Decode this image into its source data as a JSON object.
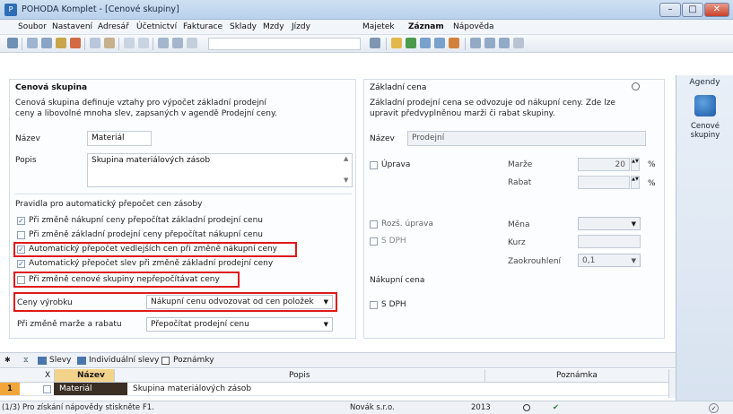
{
  "window": {
    "title": "POHODA Komplet - [Cenové skupiny]"
  },
  "menu": [
    "Soubor",
    "Nastavení",
    "Adresář",
    "Účetnictví",
    "Fakturace",
    "Sklady",
    "Mzdy",
    "Jízdy",
    "Majetek",
    "Záznam",
    "Nápověda"
  ],
  "left": {
    "section_title": "Cenová skupina",
    "description": "Cenová skupina definuje vztahy pro výpočet základní prodejní ceny a libovolné mnoha slev, zapsaných v agendě Prodejní ceny.",
    "name_label": "Název",
    "name_value": "Materiál",
    "desc_label": "Popis",
    "desc_value": "Skupina materiálových zásob",
    "rules_title": "Pravidla pro automatický přepočet cen zásoby",
    "checks": [
      {
        "label": "Při změně nákupní ceny přepočítat základní prodejní cenu",
        "checked": true
      },
      {
        "label": "Při změně základní prodejní ceny přepočítat nákupní cenu",
        "checked": false
      },
      {
        "label": "Automatický přepočet vedlejších cen při změně nákupní ceny",
        "checked": true
      },
      {
        "label": "Automatický přepočet slev při změně základní prodejní ceny",
        "checked": true
      },
      {
        "label": "Při změně cenové skupiny nepřepočítávat ceny",
        "checked": false
      }
    ],
    "ceny_label": "Ceny výrobku",
    "ceny_value": "Nákupní cenu odvozovat od cen položek",
    "marze_label": "Při změně marže a rabatu",
    "marze_value": "Přepočítat prodejní cenu"
  },
  "right": {
    "section_title": "Základní cena",
    "description": "Základní prodejní cena se odvozuje od nákupní ceny. Zde lze upravit předvyplněnou marži či rabat skupiny.",
    "name_label": "Název",
    "name_value": "Prodejní",
    "uprava_label": "Úprava",
    "marze_label": "Marže",
    "marze_value": "20",
    "rabat_label": "Rabat",
    "pct": "%",
    "rozs_label": "Rozš. úprava",
    "sdph_label": "S DPH",
    "mena_label": "Měna",
    "kurz_label": "Kurz",
    "zaokr_label": "Zaokrouhlení",
    "zaokr_value": "0,1",
    "nakupni_title": "Nákupní cena",
    "nakupni_sdph": "S DPH"
  },
  "agendy": {
    "title": "Agendy",
    "item": "Cenové skupiny"
  },
  "tabs": [
    "Slevy",
    "Individuální slevy",
    "Poznámky"
  ],
  "grid": {
    "headers": [
      "X",
      "Název",
      "Popis",
      "Poznámka"
    ],
    "row": {
      "num": "1",
      "name": "Materiál",
      "popis": "Skupina materiálových zásob"
    }
  },
  "status": {
    "hint": "(1/3) Pro získání nápovědy stiskněte F1.",
    "company": "Novák s.r.o.",
    "year": "2013"
  }
}
